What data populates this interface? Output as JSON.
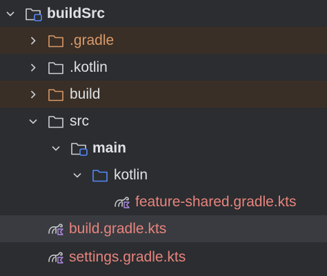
{
  "tree": {
    "items": [
      {
        "label": "buildSrc",
        "icon": "module-folder-icon",
        "expanded": true
      },
      {
        "label": ".gradle",
        "icon": "folder-icon",
        "expanded": false,
        "status": "excluded"
      },
      {
        "label": ".kotlin",
        "icon": "folder-icon",
        "expanded": false
      },
      {
        "label": "build",
        "icon": "folder-icon",
        "expanded": false,
        "status": "excluded"
      },
      {
        "label": "src",
        "icon": "folder-icon",
        "expanded": true
      },
      {
        "label": "main",
        "icon": "source-set-folder-icon",
        "expanded": true
      },
      {
        "label": "kotlin",
        "icon": "source-root-folder-icon",
        "expanded": true
      },
      {
        "label": "feature-shared.gradle.kts",
        "icon": "gradle-kotlin-script-icon"
      },
      {
        "label": "build.gradle.kts",
        "icon": "gradle-kotlin-script-icon",
        "selected": true
      },
      {
        "label": "settings.gradle.kts",
        "icon": "gradle-kotlin-script-icon"
      }
    ]
  },
  "colors": {
    "background": "#2b2d30",
    "excluded_row": "#3a2f26",
    "selected_row": "#393b40",
    "excluded_text": "#d89a6a",
    "modified_file_text": "#e8847d",
    "source_root_blue": "#548af7"
  }
}
